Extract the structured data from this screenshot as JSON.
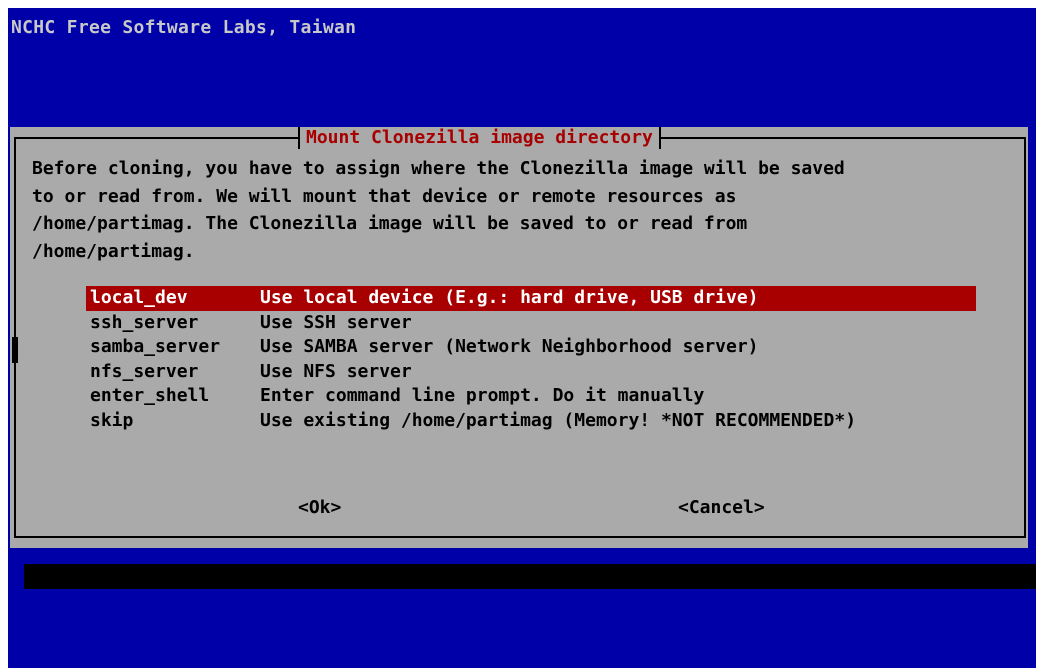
{
  "backtitle": "NCHC Free Software Labs, Taiwan",
  "dialog": {
    "title": "Mount Clonezilla image directory",
    "prompt_lines": [
      "Before cloning, you have to assign where the Clonezilla image will be saved",
      "to or read from. We will mount that device or remote resources as",
      "/home/partimag. The Clonezilla image will be saved to or read from",
      "/home/partimag."
    ],
    "menu": [
      {
        "tag": "local_dev",
        "desc": "Use local device (E.g.: hard drive, USB drive)",
        "selected": true
      },
      {
        "tag": "ssh_server",
        "desc": "Use SSH server",
        "selected": false
      },
      {
        "tag": "samba_server",
        "desc": "Use SAMBA server (Network Neighborhood server)",
        "selected": false
      },
      {
        "tag": "nfs_server",
        "desc": "Use NFS server",
        "selected": false
      },
      {
        "tag": "enter_shell",
        "desc": "Enter command line prompt. Do it manually",
        "selected": false
      },
      {
        "tag": "skip",
        "desc": "Use existing /home/partimag (Memory! *NOT RECOMMENDED*)",
        "selected": false
      }
    ],
    "ok_label": "<Ok>",
    "cancel_label": "<Cancel>"
  },
  "colors": {
    "screen_bg": "#0000a8",
    "dialog_bg": "#aaaaaa",
    "accent": "#a80000",
    "text": "#000000"
  }
}
